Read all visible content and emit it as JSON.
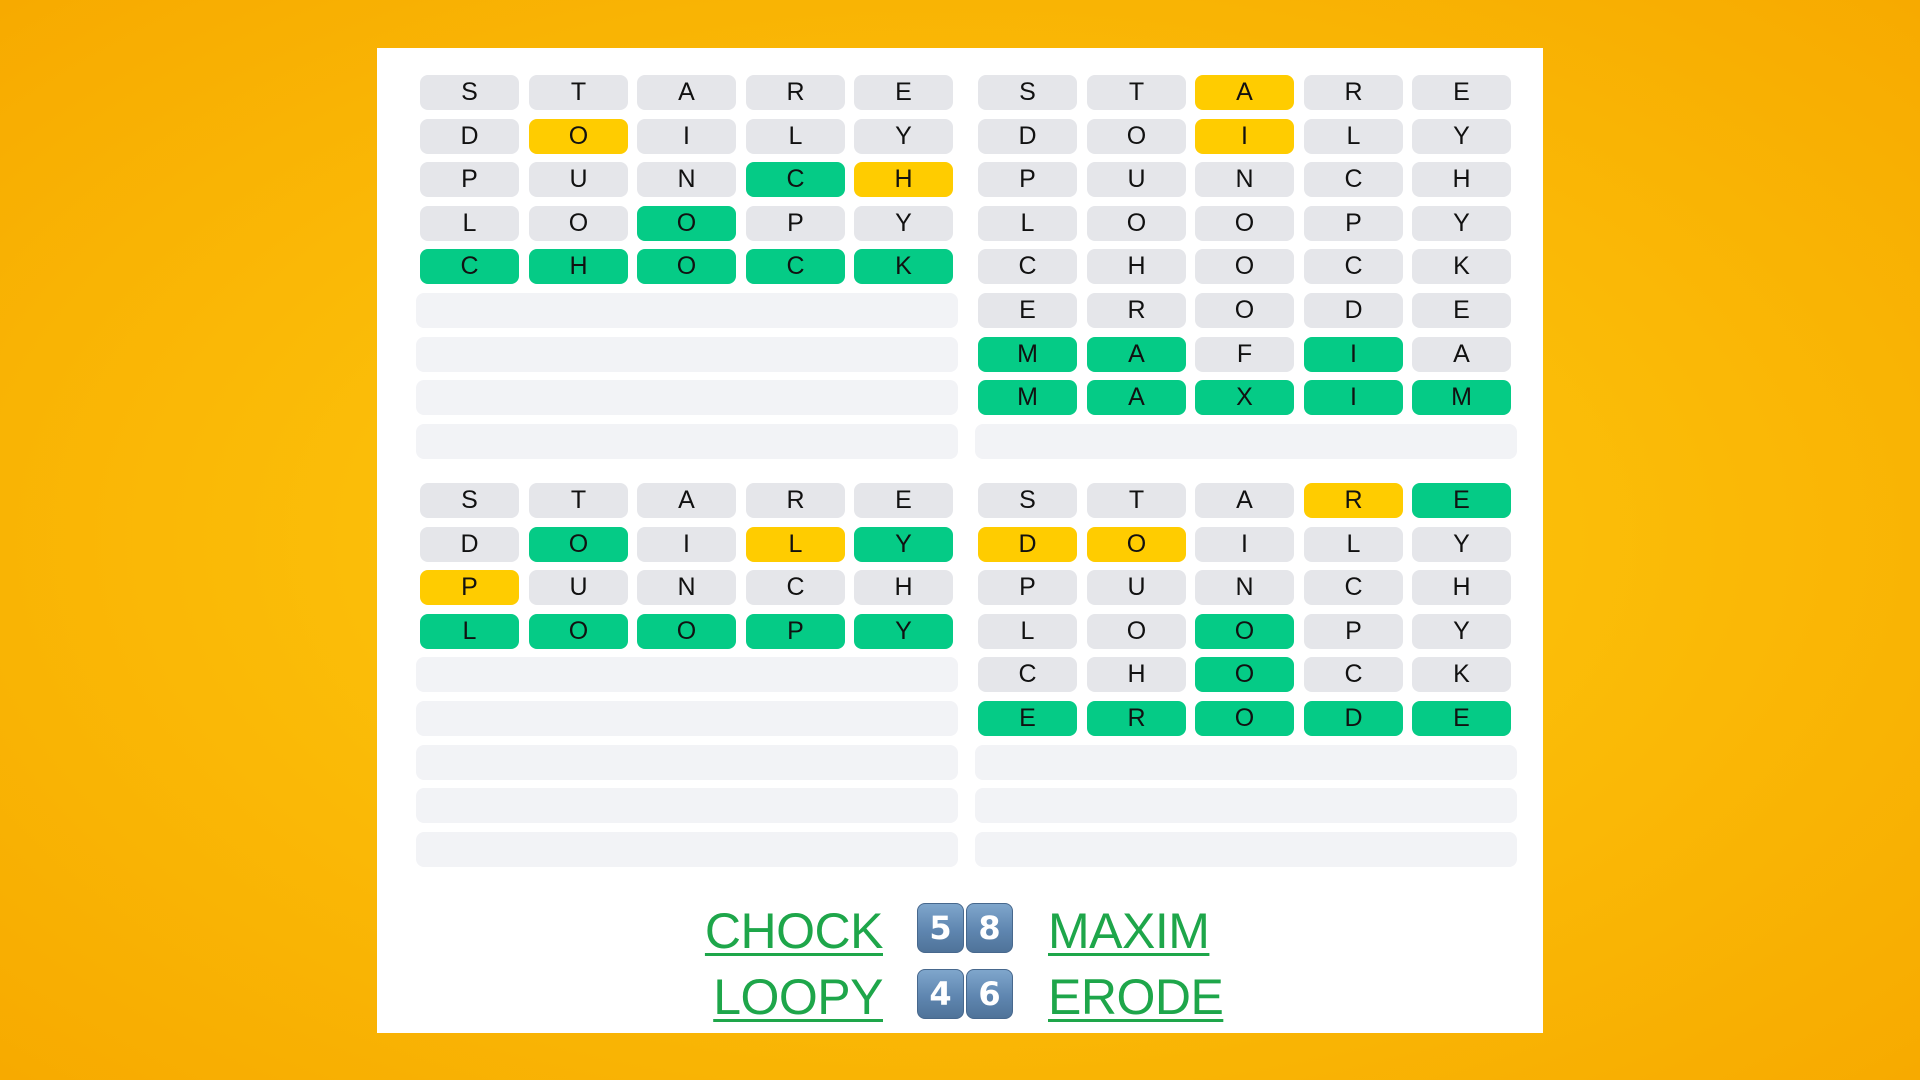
{
  "colors": {
    "correct": "#05cb86",
    "present": "#ffcc00",
    "absent": "#e5e6ea",
    "empty": "#f2f3f6",
    "answer_link": "#1ea64a",
    "background": "#f9b800"
  },
  "total_rows_per_board": 9,
  "boards": [
    {
      "id": "top-left",
      "answer": "CHOCK",
      "guesses": [
        {
          "word": "STARE",
          "states": [
            "absent",
            "absent",
            "absent",
            "absent",
            "absent"
          ]
        },
        {
          "word": "DOILY",
          "states": [
            "absent",
            "present",
            "absent",
            "absent",
            "absent"
          ]
        },
        {
          "word": "PUNCH",
          "states": [
            "absent",
            "absent",
            "absent",
            "correct",
            "present"
          ]
        },
        {
          "word": "LOOPY",
          "states": [
            "absent",
            "absent",
            "correct",
            "absent",
            "absent"
          ]
        },
        {
          "word": "CHOCK",
          "states": [
            "correct",
            "correct",
            "correct",
            "correct",
            "correct"
          ]
        }
      ]
    },
    {
      "id": "top-right",
      "answer": "MAXIM",
      "guesses": [
        {
          "word": "STARE",
          "states": [
            "absent",
            "absent",
            "present",
            "absent",
            "absent"
          ]
        },
        {
          "word": "DOILY",
          "states": [
            "absent",
            "absent",
            "present",
            "absent",
            "absent"
          ]
        },
        {
          "word": "PUNCH",
          "states": [
            "absent",
            "absent",
            "absent",
            "absent",
            "absent"
          ]
        },
        {
          "word": "LOOPY",
          "states": [
            "absent",
            "absent",
            "absent",
            "absent",
            "absent"
          ]
        },
        {
          "word": "CHOCK",
          "states": [
            "absent",
            "absent",
            "absent",
            "absent",
            "absent"
          ]
        },
        {
          "word": "ERODE",
          "states": [
            "absent",
            "absent",
            "absent",
            "absent",
            "absent"
          ]
        },
        {
          "word": "MAFIA",
          "states": [
            "correct",
            "correct",
            "absent",
            "correct",
            "absent"
          ]
        },
        {
          "word": "MAXIM",
          "states": [
            "correct",
            "correct",
            "correct",
            "correct",
            "correct"
          ]
        }
      ]
    },
    {
      "id": "bottom-left",
      "answer": "LOOPY",
      "guesses": [
        {
          "word": "STARE",
          "states": [
            "absent",
            "absent",
            "absent",
            "absent",
            "absent"
          ]
        },
        {
          "word": "DOILY",
          "states": [
            "absent",
            "correct",
            "absent",
            "present",
            "correct"
          ]
        },
        {
          "word": "PUNCH",
          "states": [
            "present",
            "absent",
            "absent",
            "absent",
            "absent"
          ]
        },
        {
          "word": "LOOPY",
          "states": [
            "correct",
            "correct",
            "correct",
            "correct",
            "correct"
          ]
        }
      ]
    },
    {
      "id": "bottom-right",
      "answer": "ERODE",
      "guesses": [
        {
          "word": "STARE",
          "states": [
            "absent",
            "absent",
            "absent",
            "present",
            "correct"
          ]
        },
        {
          "word": "DOILY",
          "states": [
            "present",
            "present",
            "absent",
            "absent",
            "absent"
          ]
        },
        {
          "word": "PUNCH",
          "states": [
            "absent",
            "absent",
            "absent",
            "absent",
            "absent"
          ]
        },
        {
          "word": "LOOPY",
          "states": [
            "absent",
            "absent",
            "correct",
            "absent",
            "absent"
          ]
        },
        {
          "word": "CHOCK",
          "states": [
            "absent",
            "absent",
            "correct",
            "absent",
            "absent"
          ]
        },
        {
          "word": "ERODE",
          "states": [
            "correct",
            "correct",
            "correct",
            "correct",
            "correct"
          ]
        }
      ]
    }
  ],
  "summary": [
    {
      "left_word": "CHOCK",
      "left_count": "5",
      "right_count": "8",
      "right_word": "MAXIM"
    },
    {
      "left_word": "LOOPY",
      "left_count": "4",
      "right_count": "6",
      "right_word": "ERODE"
    }
  ]
}
